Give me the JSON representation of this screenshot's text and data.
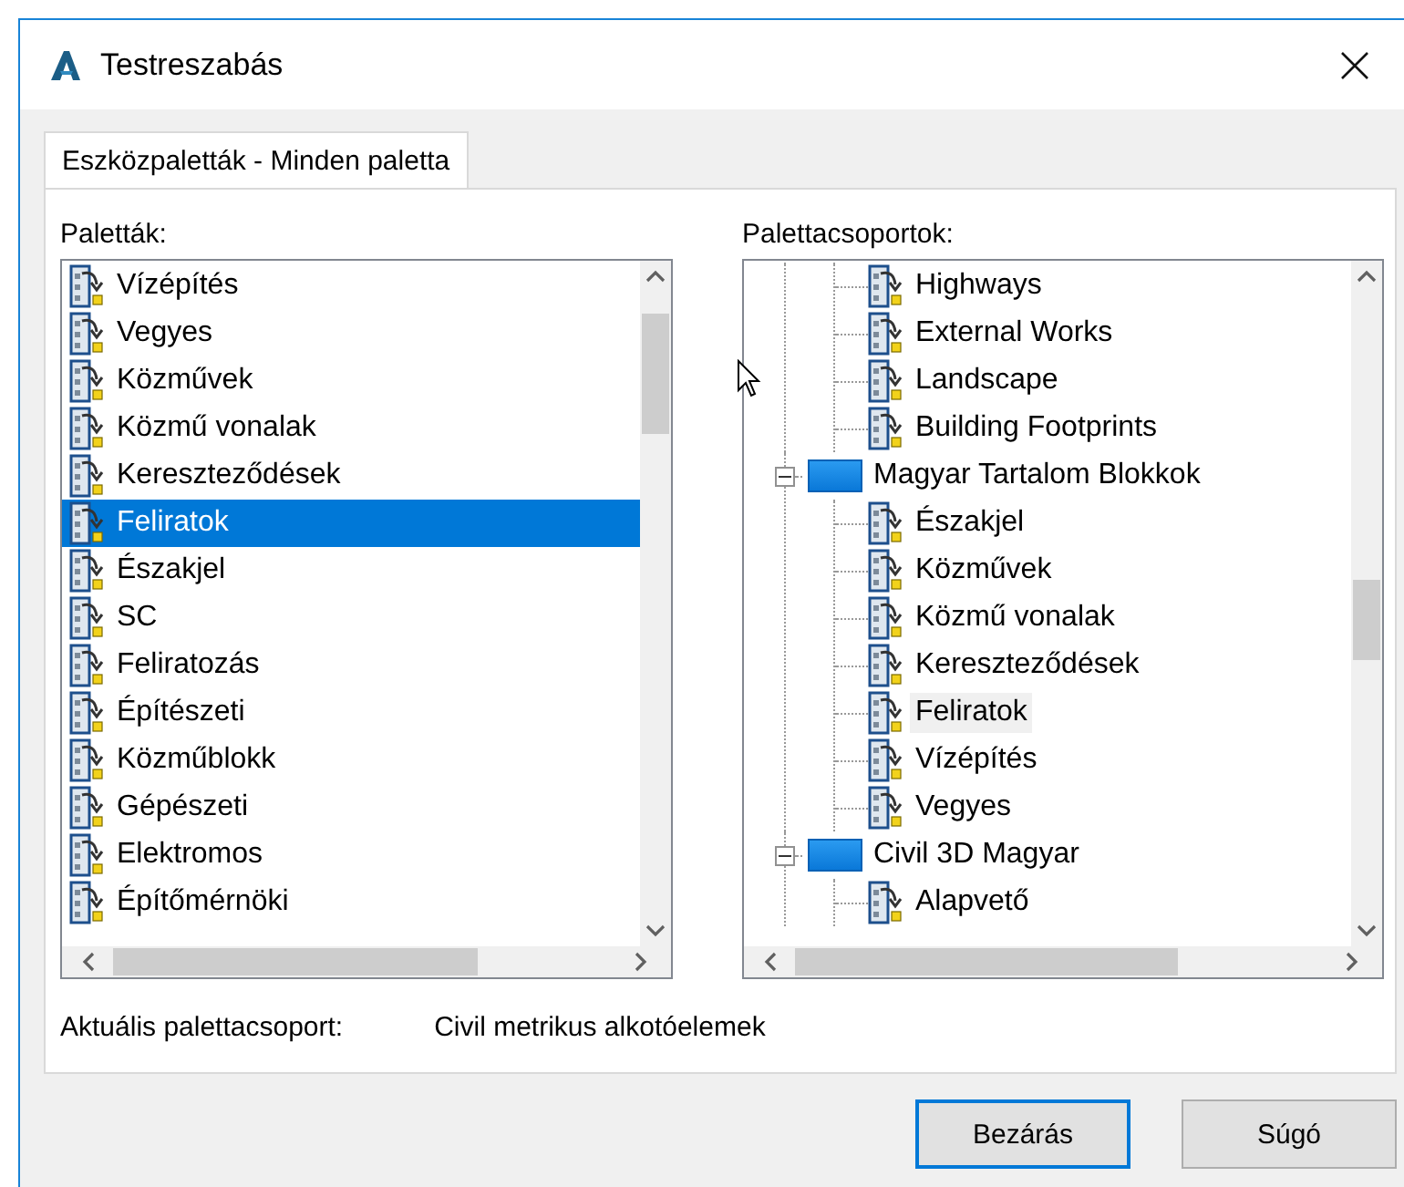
{
  "window": {
    "title": "Testreszabás"
  },
  "tabs": [
    {
      "label": "Eszközpaletták - Minden paletta",
      "selected": true
    }
  ],
  "palettes": {
    "label": "Paletták:",
    "items": [
      {
        "label": "Vízépítés",
        "selected": false
      },
      {
        "label": "Vegyes",
        "selected": false
      },
      {
        "label": "Közművek",
        "selected": false
      },
      {
        "label": "Közmű vonalak",
        "selected": false
      },
      {
        "label": "Kereszteződések",
        "selected": false
      },
      {
        "label": "Feliratok",
        "selected": true
      },
      {
        "label": "Északjel",
        "selected": false
      },
      {
        "label": "SC",
        "selected": false
      },
      {
        "label": "Feliratozás",
        "selected": false
      },
      {
        "label": "Építészeti",
        "selected": false
      },
      {
        "label": "Közműblokk",
        "selected": false
      },
      {
        "label": "Gépészeti",
        "selected": false
      },
      {
        "label": "Elektromos",
        "selected": false
      },
      {
        "label": "Építőmérnöki",
        "selected": false
      }
    ]
  },
  "palette_groups": {
    "label": "Palettacsoportok:",
    "groups": [
      {
        "children": [
          {
            "label": "Highways",
            "selected": false
          },
          {
            "label": "External Works",
            "selected": false
          },
          {
            "label": "Landscape",
            "selected": false
          },
          {
            "label": "Building Footprints",
            "selected": false
          }
        ]
      },
      {
        "label": "Magyar Tartalom Blokkok",
        "expanded": true,
        "children": [
          {
            "label": "Északjel",
            "selected": false
          },
          {
            "label": "Közművek",
            "selected": false
          },
          {
            "label": "Közmű vonalak",
            "selected": false
          },
          {
            "label": "Kereszteződések",
            "selected": false
          },
          {
            "label": "Feliratok",
            "selected": true
          },
          {
            "label": "Vízépítés",
            "selected": false
          },
          {
            "label": "Vegyes",
            "selected": false
          }
        ]
      },
      {
        "label": "Civil 3D Magyar",
        "expanded": true,
        "children": [
          {
            "label": "Alapvető",
            "selected": false
          }
        ]
      }
    ]
  },
  "current_group": {
    "label": "Aktuális palettacsoport:",
    "value": "Civil metrikus alkotóelemek"
  },
  "buttons": [
    {
      "label": "Bezárás",
      "default": true
    },
    {
      "label": "Súgó",
      "default": false
    }
  ]
}
